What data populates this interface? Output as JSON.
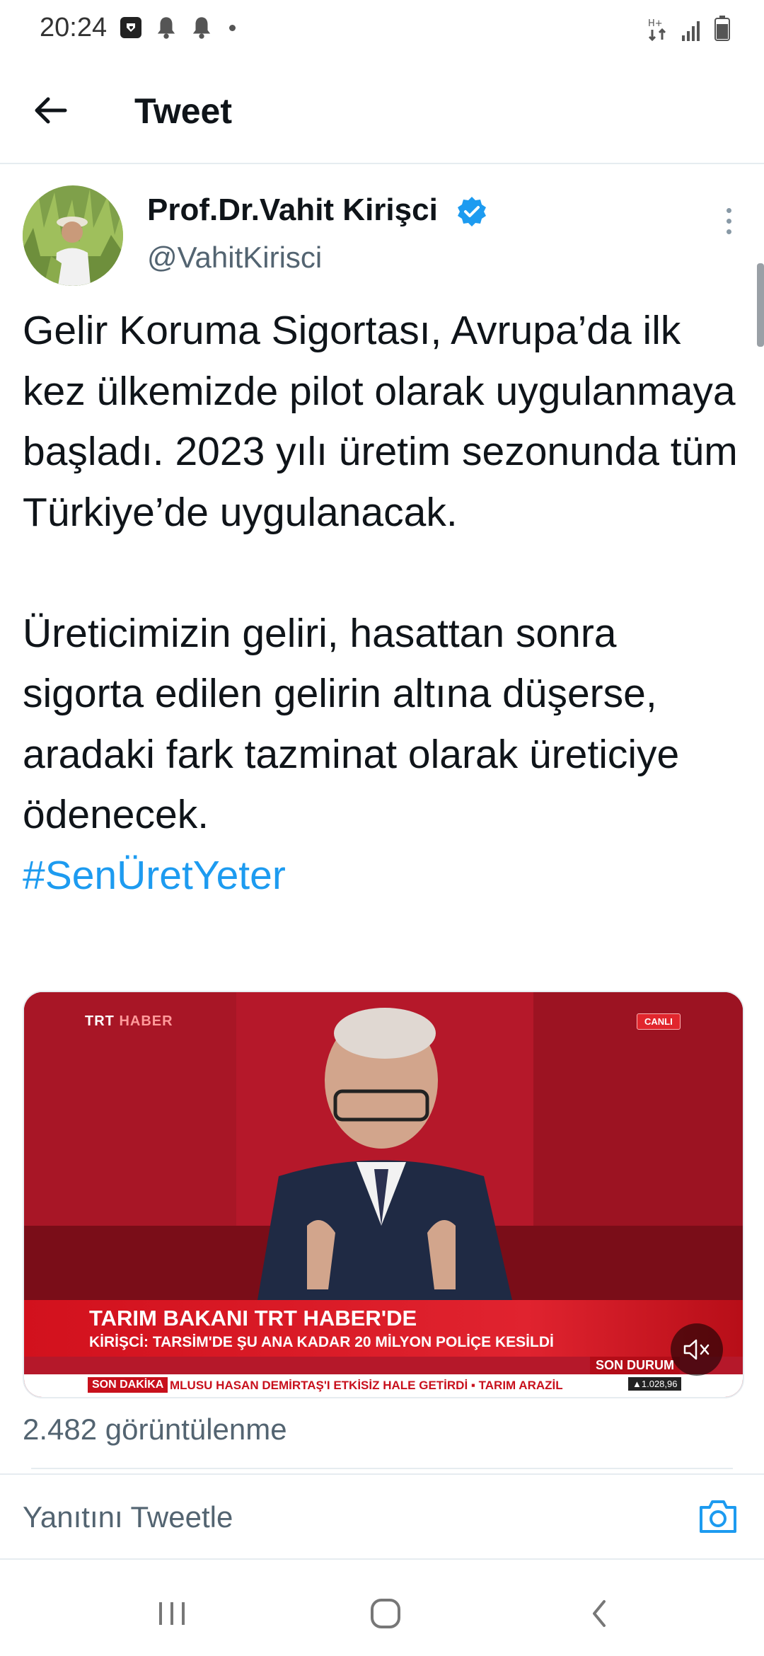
{
  "status_bar": {
    "time": "20:24",
    "left_icons": [
      "app-notification-icon",
      "bell-icon",
      "bell-icon",
      "dot-icon"
    ],
    "right_icons": [
      "data-arrows-icon",
      "signal-icon",
      "battery-icon"
    ]
  },
  "header": {
    "back_icon": "arrow-left-icon",
    "title": "Tweet"
  },
  "tweet": {
    "author_name": "Prof.Dr.Vahit Kirişci",
    "author_handle": "@VahitKirisci",
    "verified": true,
    "text": "Gelir Koruma Sigortası, Avrupa’da ilk kez ülkemizde pilot olarak uygulanmaya başladı. 2023 yılı üretim sezonunda tüm Türkiye’de uygulanacak.\n\nÜreticimizin geliri, hasattan sonra sigorta edilen gelirin altına düşerse, aradaki fark tazminat olarak üreticiye ödenecek.",
    "hashtag": "#SenÜretYeter",
    "view_count": "2.482 görüntülenme"
  },
  "media": {
    "channel_brand": "TRT",
    "channel_sub": "HABER",
    "live_label": "CANLI",
    "headline": "TARIM BAKANI TRT HABER'DE",
    "subheadline": "KİRİŞCİ: TARSİM'DE ŞU ANA KADAR 20 MİLYON POLİÇE KESİLDİ",
    "son_durum": "SON DURUM",
    "ticker_tag": "SON DAKİKA",
    "ticker_text": "MLUSU HASAN DEMİRTAŞ'I ETKİSİZ HALE GETİRDİ   ▪  TARIM ARAZİL",
    "ticker_index": "▲1.028,96",
    "mute_icon": "speaker-muted-icon"
  },
  "reply": {
    "placeholder": "Yanıtını Tweetle",
    "camera_icon": "camera-icon"
  },
  "nav": {
    "icons": [
      "recent-apps-icon",
      "home-icon",
      "back-icon"
    ]
  },
  "colors": {
    "accent": "#1d9bf0",
    "secondary_text": "#536471",
    "divider": "#e6ecf0",
    "trt_red": "#c8101c"
  }
}
